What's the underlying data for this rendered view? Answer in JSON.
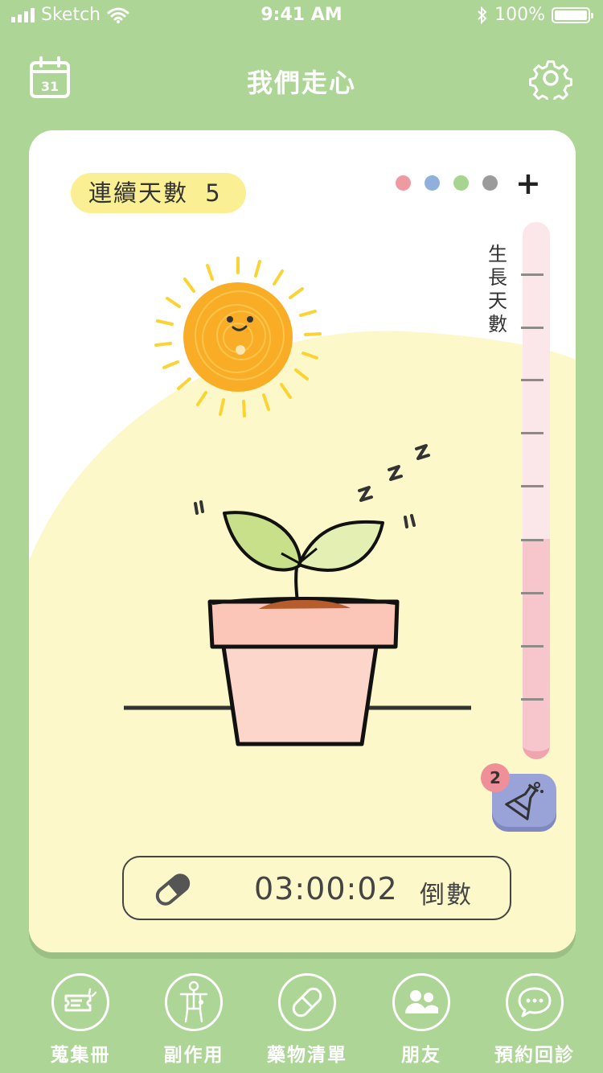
{
  "status_bar": {
    "carrier": "Sketch",
    "time": "9:41 AM",
    "battery": "100%"
  },
  "header": {
    "title": "我們走心",
    "calendar_day": "31"
  },
  "card": {
    "streak_label": "連續天數",
    "streak_value": "5",
    "color_dots": [
      "#ef9aa3",
      "#8fb0dc",
      "#a6d58f",
      "#9b9b9b"
    ],
    "add_label": "+",
    "growth_label": "生長天數",
    "growth_level": 0.41,
    "potion_badge": "2",
    "timer": {
      "time": "03:00:02",
      "label": "倒數"
    }
  },
  "tabs": [
    {
      "label": "蒐集冊"
    },
    {
      "label": "副作用"
    },
    {
      "label": "藥物清單"
    },
    {
      "label": "朋友"
    },
    {
      "label": "預約回診"
    }
  ]
}
